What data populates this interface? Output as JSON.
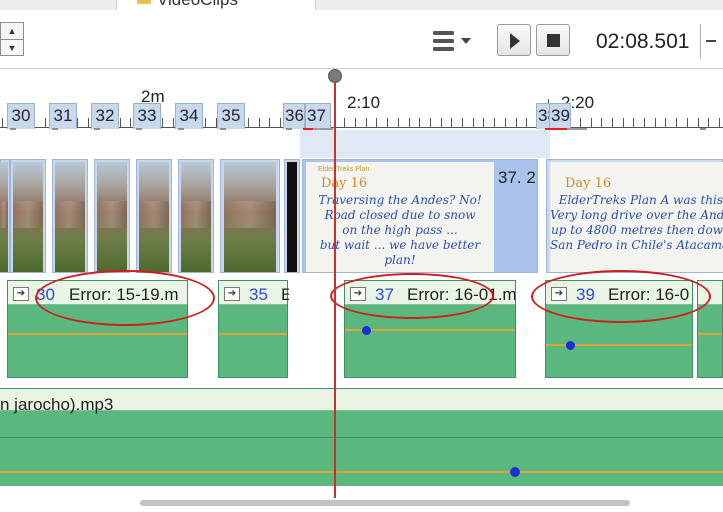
{
  "header": {
    "folder_label": "VideoClips",
    "spin_up": "▲",
    "spin_down": "▼",
    "time_readout": "02:08.501"
  },
  "ruler": {
    "minute_label": "2m",
    "time_labels": [
      "2:10",
      "2:20"
    ],
    "markers": [
      "30",
      "31",
      "32",
      "33",
      "34",
      "35",
      "36",
      "37",
      "38",
      "39"
    ]
  },
  "video_track": {
    "clip37_length": "37. 2",
    "slides": [
      {
        "brand": "Elder Treks Plan",
        "day": "Day 16",
        "lines": [
          "Traversing the Andes?  No!",
          "Road closed due to snow",
          "on the high pass ...",
          "but wait ... we have better plan!"
        ]
      },
      {
        "brand": "",
        "day": "Day 16",
        "lines": [
          "ElderTreks Plan A was this",
          "Very long drive over the Ande",
          "up to 4800 metres then dow",
          "San Pedro in Chile's Atacama De"
        ]
      }
    ]
  },
  "overlay_track": {
    "clips": [
      {
        "num": "30",
        "error": "Error: 15-19.m"
      },
      {
        "num": "35",
        "error": "E"
      },
      {
        "num": "37",
        "error": "Error: 16-01.m"
      },
      {
        "num": "39",
        "error": "Error: 16-0"
      }
    ],
    "tag_glyph": "➔"
  },
  "audio_track": {
    "label": "n jarocho).mp3"
  },
  "colors": {
    "playhead": "#c93030",
    "error_highlight": "#cc1f1f",
    "track_green": "#5ab87f",
    "clip_blue": "#c6d7ef"
  }
}
